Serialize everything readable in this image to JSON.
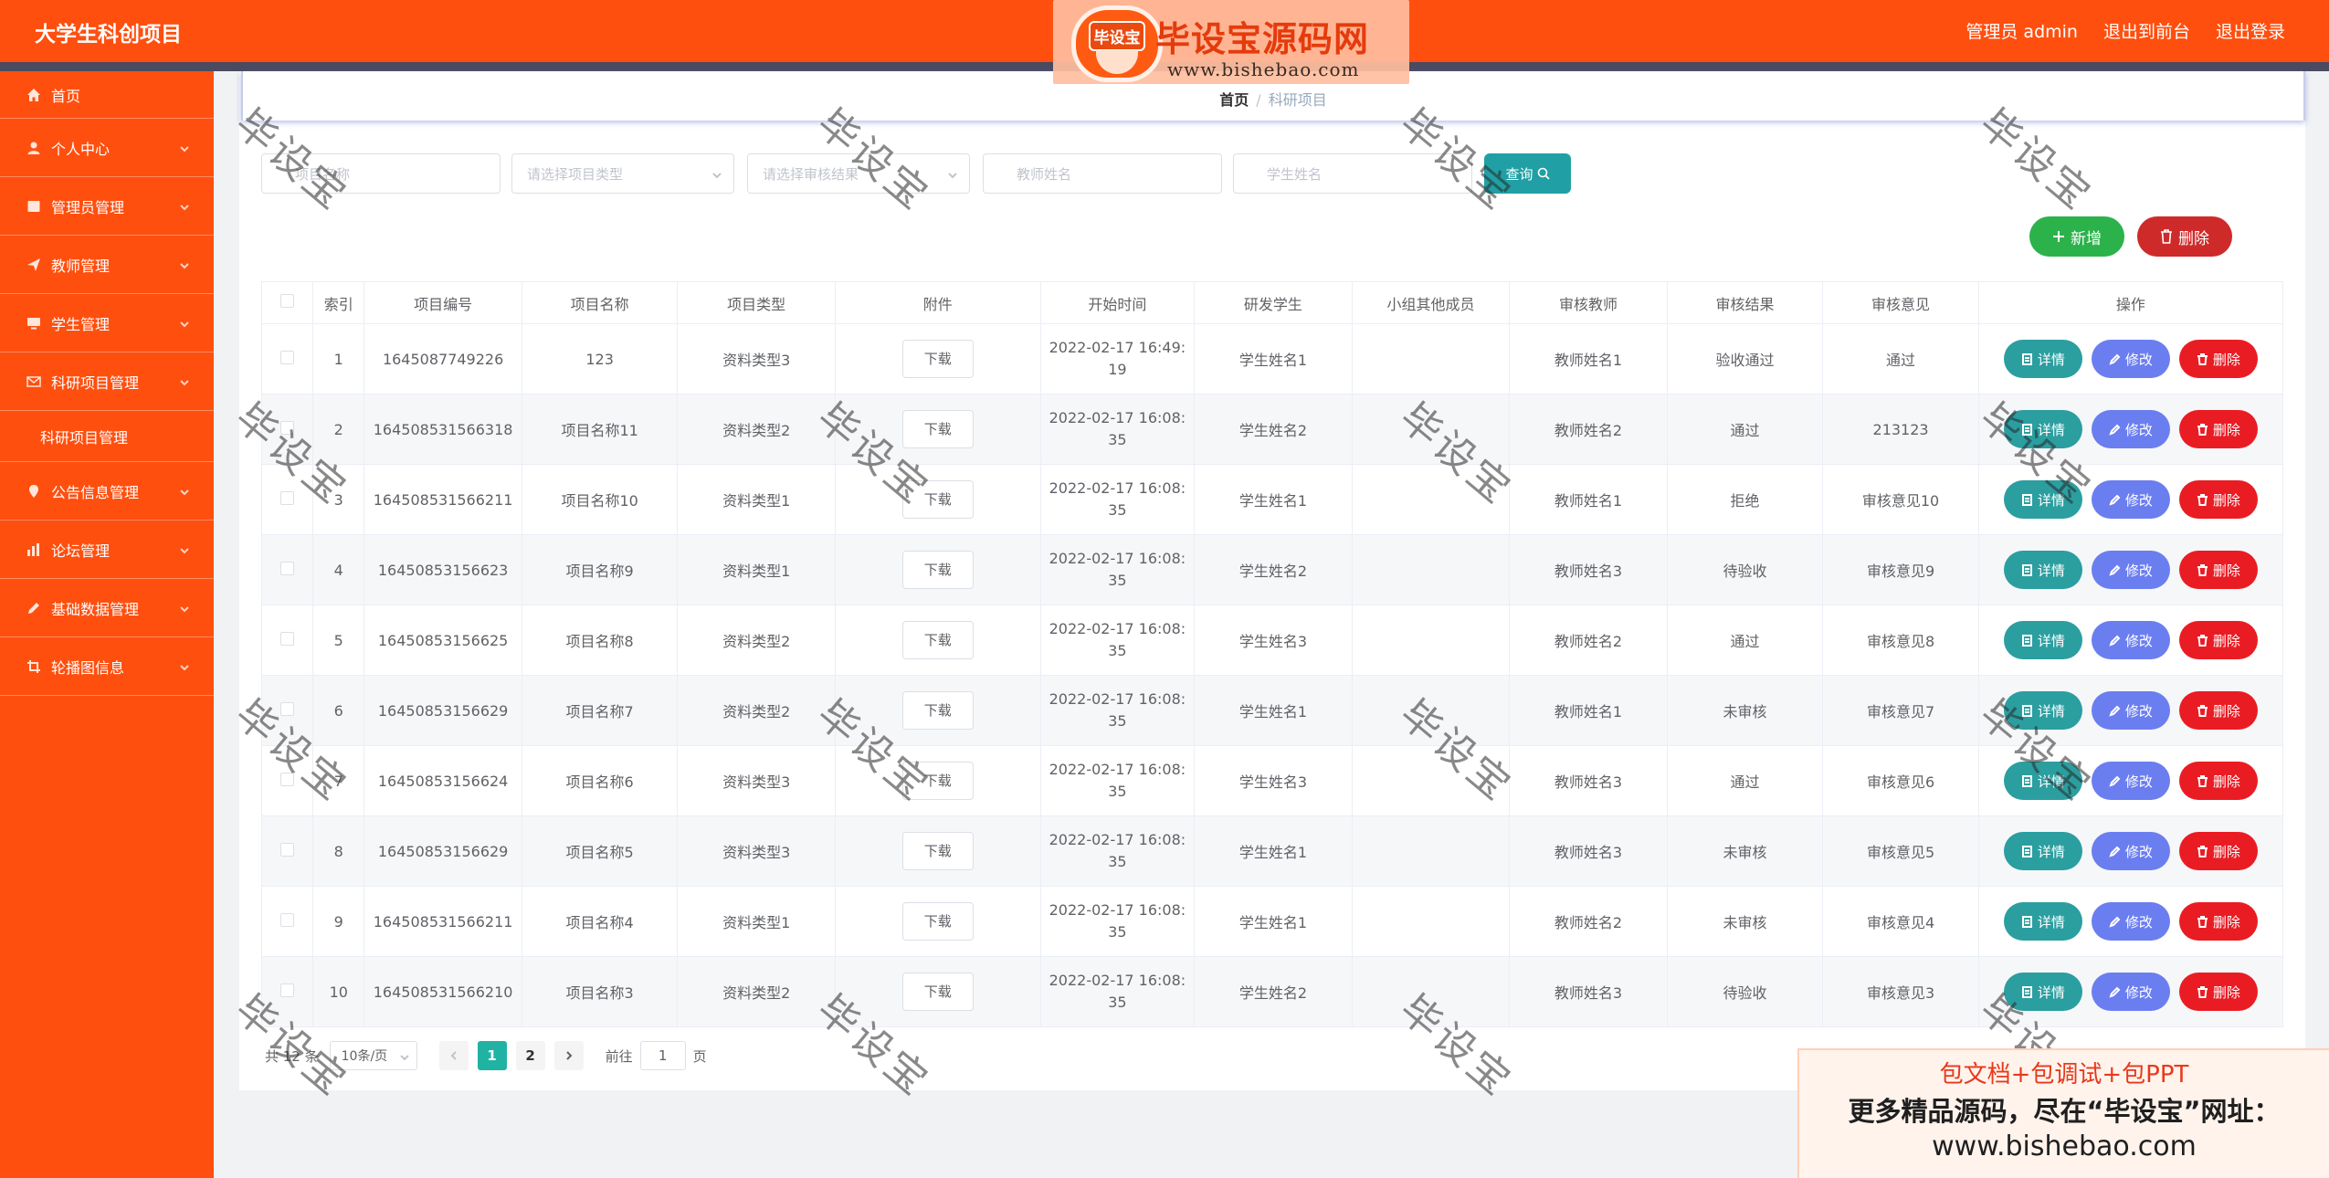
{
  "app_title": "大学生科创项目",
  "top_links": {
    "admin": "管理员 admin",
    "front": "退出到前台",
    "logout": "退出登录"
  },
  "logo": {
    "badge": "毕设宝",
    "title": "毕设宝源码网",
    "url": "www.bishebao.com"
  },
  "sidebar": {
    "items": [
      {
        "label": "首页",
        "icon": "home-icon"
      },
      {
        "label": "个人中心",
        "icon": "user-icon"
      },
      {
        "label": "管理员管理",
        "icon": "admin-icon"
      },
      {
        "label": "教师管理",
        "icon": "send-icon"
      },
      {
        "label": "学生管理",
        "icon": "monitor-icon"
      },
      {
        "label": "科研项目管理",
        "icon": "mail-icon"
      },
      {
        "label": "公告信息管理",
        "icon": "location-icon"
      },
      {
        "label": "论坛管理",
        "icon": "chart-icon"
      },
      {
        "label": "基础数据管理",
        "icon": "edit-icon"
      },
      {
        "label": "轮播图信息",
        "icon": "crop-icon"
      }
    ],
    "subitem": "科研项目管理"
  },
  "breadcrumb": {
    "home": "首页",
    "sep": "/",
    "current": "科研项目"
  },
  "search": {
    "project_name": "项目名称",
    "project_type": "请选择项目类型",
    "review_result": "请选择审核结果",
    "teacher_name": "教师姓名",
    "student_name": "学生姓名",
    "query_label": "查询"
  },
  "actions": {
    "add": "新增",
    "delete": "删除"
  },
  "table": {
    "headers": [
      "索引",
      "项目编号",
      "项目名称",
      "项目类型",
      "附件",
      "开始时间",
      "研发学生",
      "小组其他成员",
      "审核教师",
      "审核结果",
      "审核意见",
      "操作"
    ],
    "download_label": "下载",
    "op_labels": {
      "detail": "详情",
      "edit": "修改",
      "remove": "删除"
    },
    "rows": [
      {
        "idx": "1",
        "code": "1645087749226",
        "name": "123",
        "type": "资料类型3",
        "time": "2022-02-17 16:49:19",
        "student": "学生姓名1",
        "members": "",
        "teacher": "教师姓名1",
        "result": "验收通过",
        "opinion": "通过"
      },
      {
        "idx": "2",
        "code": "164508531566318",
        "name": "项目名称11",
        "type": "资料类型2",
        "time": "2022-02-17 16:08:35",
        "student": "学生姓名2",
        "members": "",
        "teacher": "教师姓名2",
        "result": "通过",
        "opinion": "213123"
      },
      {
        "idx": "3",
        "code": "164508531566211",
        "name": "项目名称10",
        "type": "资料类型1",
        "time": "2022-02-17 16:08:35",
        "student": "学生姓名1",
        "members": "",
        "teacher": "教师姓名1",
        "result": "拒绝",
        "opinion": "审核意见10"
      },
      {
        "idx": "4",
        "code": "16450853156623",
        "name": "项目名称9",
        "type": "资料类型1",
        "time": "2022-02-17 16:08:35",
        "student": "学生姓名2",
        "members": "",
        "teacher": "教师姓名3",
        "result": "待验收",
        "opinion": "审核意见9"
      },
      {
        "idx": "5",
        "code": "16450853156625",
        "name": "项目名称8",
        "type": "资料类型2",
        "time": "2022-02-17 16:08:35",
        "student": "学生姓名3",
        "members": "",
        "teacher": "教师姓名2",
        "result": "通过",
        "opinion": "审核意见8"
      },
      {
        "idx": "6",
        "code": "16450853156629",
        "name": "项目名称7",
        "type": "资料类型2",
        "time": "2022-02-17 16:08:35",
        "student": "学生姓名1",
        "members": "",
        "teacher": "教师姓名1",
        "result": "未审核",
        "opinion": "审核意见7"
      },
      {
        "idx": "7",
        "code": "16450853156624",
        "name": "项目名称6",
        "type": "资料类型3",
        "time": "2022-02-17 16:08:35",
        "student": "学生姓名3",
        "members": "",
        "teacher": "教师姓名3",
        "result": "通过",
        "opinion": "审核意见6"
      },
      {
        "idx": "8",
        "code": "16450853156629",
        "name": "项目名称5",
        "type": "资料类型3",
        "time": "2022-02-17 16:08:35",
        "student": "学生姓名1",
        "members": "",
        "teacher": "教师姓名3",
        "result": "未审核",
        "opinion": "审核意见5"
      },
      {
        "idx": "9",
        "code": "164508531566211",
        "name": "项目名称4",
        "type": "资料类型1",
        "time": "2022-02-17 16:08:35",
        "student": "学生姓名1",
        "members": "",
        "teacher": "教师姓名2",
        "result": "未审核",
        "opinion": "审核意见4"
      },
      {
        "idx": "10",
        "code": "164508531566210",
        "name": "项目名称3",
        "type": "资料类型2",
        "time": "2022-02-17 16:08:35",
        "student": "学生姓名2",
        "members": "",
        "teacher": "教师姓名3",
        "result": "待验收",
        "opinion": "审核意见3"
      }
    ]
  },
  "pagination": {
    "total": "共 12 条",
    "page_size": "10条/页",
    "pages": [
      "1",
      "2"
    ],
    "current": "1",
    "goto_prefix": "前往",
    "goto_value": "1",
    "goto_suffix": "页"
  },
  "watermark": "毕设宝",
  "ad": {
    "line1": "包文档+包调试+包PPT",
    "line2": "更多精品源码，尽在“毕设宝”网址：",
    "line3": "www.bishebao.com"
  },
  "colors": {
    "topbar": "#ff4f0f",
    "sidebar": "#ff4f0f",
    "query": "#20a0a4",
    "add": "#2cb24b",
    "delete": "#cf2a2a",
    "detail": "#2b9ea0",
    "edit": "#6b7ef0",
    "remove": "#ea1c23",
    "page_active": "#20b3a4"
  }
}
